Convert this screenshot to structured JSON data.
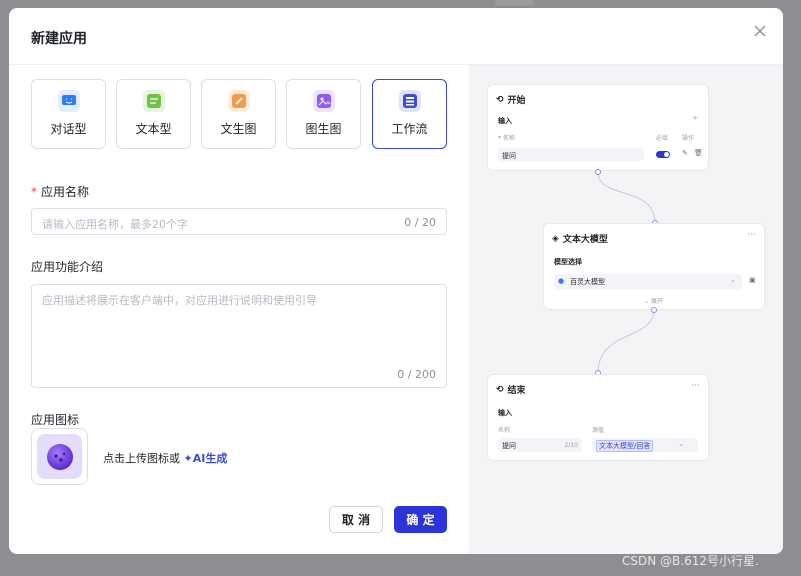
{
  "modal": {
    "title": "新建应用"
  },
  "types": [
    {
      "label": "对话型",
      "icon": "chat-icon",
      "color": "#2f7cf6"
    },
    {
      "label": "文本型",
      "icon": "text-icon",
      "color": "#6cc24a"
    },
    {
      "label": "文生图",
      "icon": "brush-icon",
      "color": "#f39b4b"
    },
    {
      "label": "图生图",
      "icon": "image-icon",
      "color": "#8d5cf6"
    },
    {
      "label": "工作流",
      "icon": "workflow-icon",
      "color": "#3d4bd6"
    }
  ],
  "selected_type": "工作流",
  "form": {
    "name_label": "应用名称",
    "name_placeholder": "请输入应用名称，最多20个字",
    "name_count": "0 / 20",
    "desc_label": "应用功能介绍",
    "desc_placeholder": "应用描述将展示在客户端中，对应用进行说明和使用引导",
    "desc_count": "0 / 200",
    "icon_label": "应用图标",
    "upload_hint": "点击上传图标或",
    "ai_generate": "✦AI生成"
  },
  "buttons": {
    "cancel": "取 消",
    "ok": "确 定"
  },
  "workflow": {
    "start": {
      "title": "开始",
      "input_label": "输入",
      "col_name": "名称",
      "col_required": "必填",
      "col_action": "操作",
      "row_name": "提问"
    },
    "llm": {
      "title": "文本大模型",
      "model_label": "模型选择",
      "model_value": "百灵大模型",
      "expand": "展开"
    },
    "end": {
      "title": "结束",
      "input_label": "输入",
      "col_name": "名称",
      "col_source": "源值",
      "row_name": "提问",
      "row_count": "2/10",
      "row_value": "文本大模型/回答"
    }
  },
  "watermark": "CSDN @B.612号小行星."
}
